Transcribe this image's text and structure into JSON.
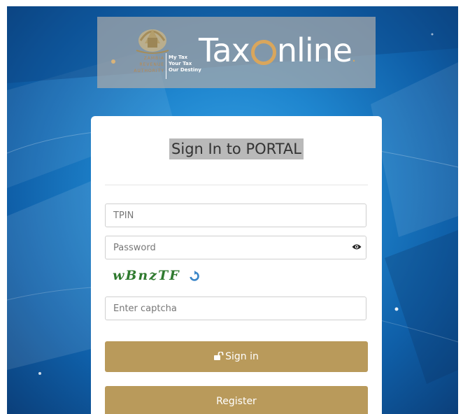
{
  "logo": {
    "authority_lines": [
      "ZAMBIA",
      "REVENUE",
      "AUTHORITY"
    ],
    "slogan_lines": [
      "My Tax",
      "Your Tax",
      "Our Destiny"
    ],
    "brand_prefix": "Tax",
    "brand_suffix": "nline",
    "brand_dot": "."
  },
  "form": {
    "title": "Sign In to PORTAL",
    "tpin_placeholder": "TPIN",
    "password_placeholder": "Password",
    "captcha_text": "wBnzTF",
    "captcha_placeholder": "Enter captcha",
    "signin_label": "Sign in",
    "register_label": "Register"
  },
  "colors": {
    "button": "#b99a5b",
    "captcha": "#2f7a2f",
    "background": "#1f86cf"
  },
  "icons": {
    "eye": "eye-icon",
    "refresh": "refresh-icon",
    "lock": "unlock-icon"
  }
}
